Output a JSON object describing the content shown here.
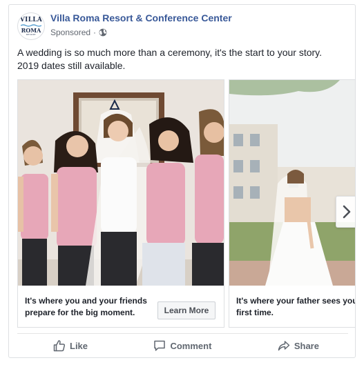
{
  "post": {
    "page_name": "Villa Roma Resort & Conference Center",
    "sponsored_label": "Sponsored",
    "separator": "·",
    "text_line1": "A wedding is so much more than a ceremony, it's the start to your story.",
    "text_line2": "2019 dates still available.",
    "logo": {
      "line1": "VILLA",
      "line2": "ROMA",
      "line3": "RESORT"
    }
  },
  "carousel": {
    "cards": [
      {
        "caption": "It's where you and your friends prepare for the big moment.",
        "cta_label": "Learn More"
      },
      {
        "caption": "It's where your father sees you as a bride for the first time."
      }
    ],
    "next_icon": "chevron-right-icon"
  },
  "actions": {
    "like_label": "Like",
    "comment_label": "Comment",
    "share_label": "Share"
  },
  "colors": {
    "page_name": "#385898",
    "secondary_text": "#616770",
    "border": "#dddfe2",
    "pink_tops": "#e7a7b8"
  }
}
